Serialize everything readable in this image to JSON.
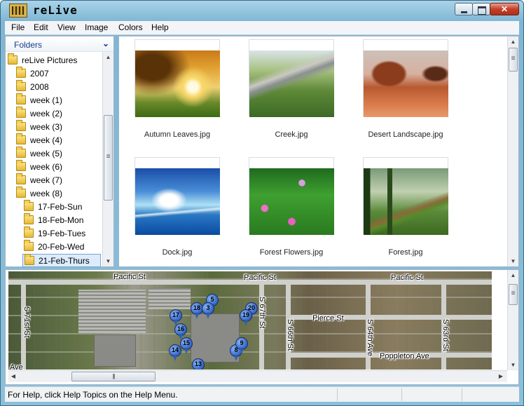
{
  "window": {
    "title": "reLive",
    "icon": "film-strip-icon",
    "controls": [
      "minimize",
      "maximize",
      "close"
    ]
  },
  "menu": [
    "File",
    "Edit",
    "View",
    "Image",
    "Colors",
    "Help"
  ],
  "folders": {
    "header": "Folders",
    "items": [
      {
        "label": "reLive Pictures",
        "level": 0
      },
      {
        "label": "2007",
        "level": 1
      },
      {
        "label": "2008",
        "level": 1
      },
      {
        "label": "week (1)",
        "level": 2
      },
      {
        "label": "week (2)",
        "level": 2
      },
      {
        "label": "week (3)",
        "level": 2
      },
      {
        "label": "week (4)",
        "level": 2
      },
      {
        "label": "week (5)",
        "level": 2
      },
      {
        "label": "week (6)",
        "level": 2
      },
      {
        "label": "week (7)",
        "level": 2
      },
      {
        "label": "week (8)",
        "level": 2
      },
      {
        "label": "17-Feb-Sun",
        "level": 3
      },
      {
        "label": "18-Feb-Mon",
        "level": 3
      },
      {
        "label": "19-Feb-Tues",
        "level": 3
      },
      {
        "label": "20-Feb-Wed",
        "level": 3
      },
      {
        "label": "21-Feb-Thurs",
        "level": 3,
        "selected": true
      }
    ]
  },
  "thumbnails": [
    {
      "name": "Autumn Leaves.jpg",
      "image": "autumn"
    },
    {
      "name": "Creek.jpg",
      "image": "creek"
    },
    {
      "name": "Desert Landscape.jpg",
      "image": "desert"
    },
    {
      "name": "Dock.jpg",
      "image": "dock"
    },
    {
      "name": "Forest Flowers.jpg",
      "image": "flowers"
    },
    {
      "name": "Forest.jpg",
      "image": "forest"
    }
  ],
  "map": {
    "streets": [
      "Pacific St",
      "Pacific St",
      "Pacific St",
      "Pierce St",
      "Poppleton Ave",
      "S 71st St",
      "S 67th St",
      "S 66th St",
      "S 64th Ave",
      "S 63rd St",
      "Ave"
    ],
    "pins": [
      "5",
      "18",
      "3",
      "20",
      "17",
      "19",
      "16",
      "15",
      "8",
      "9",
      "14",
      "13"
    ]
  },
  "status": {
    "text": "For Help, click Help Topics on the Help Menu."
  }
}
